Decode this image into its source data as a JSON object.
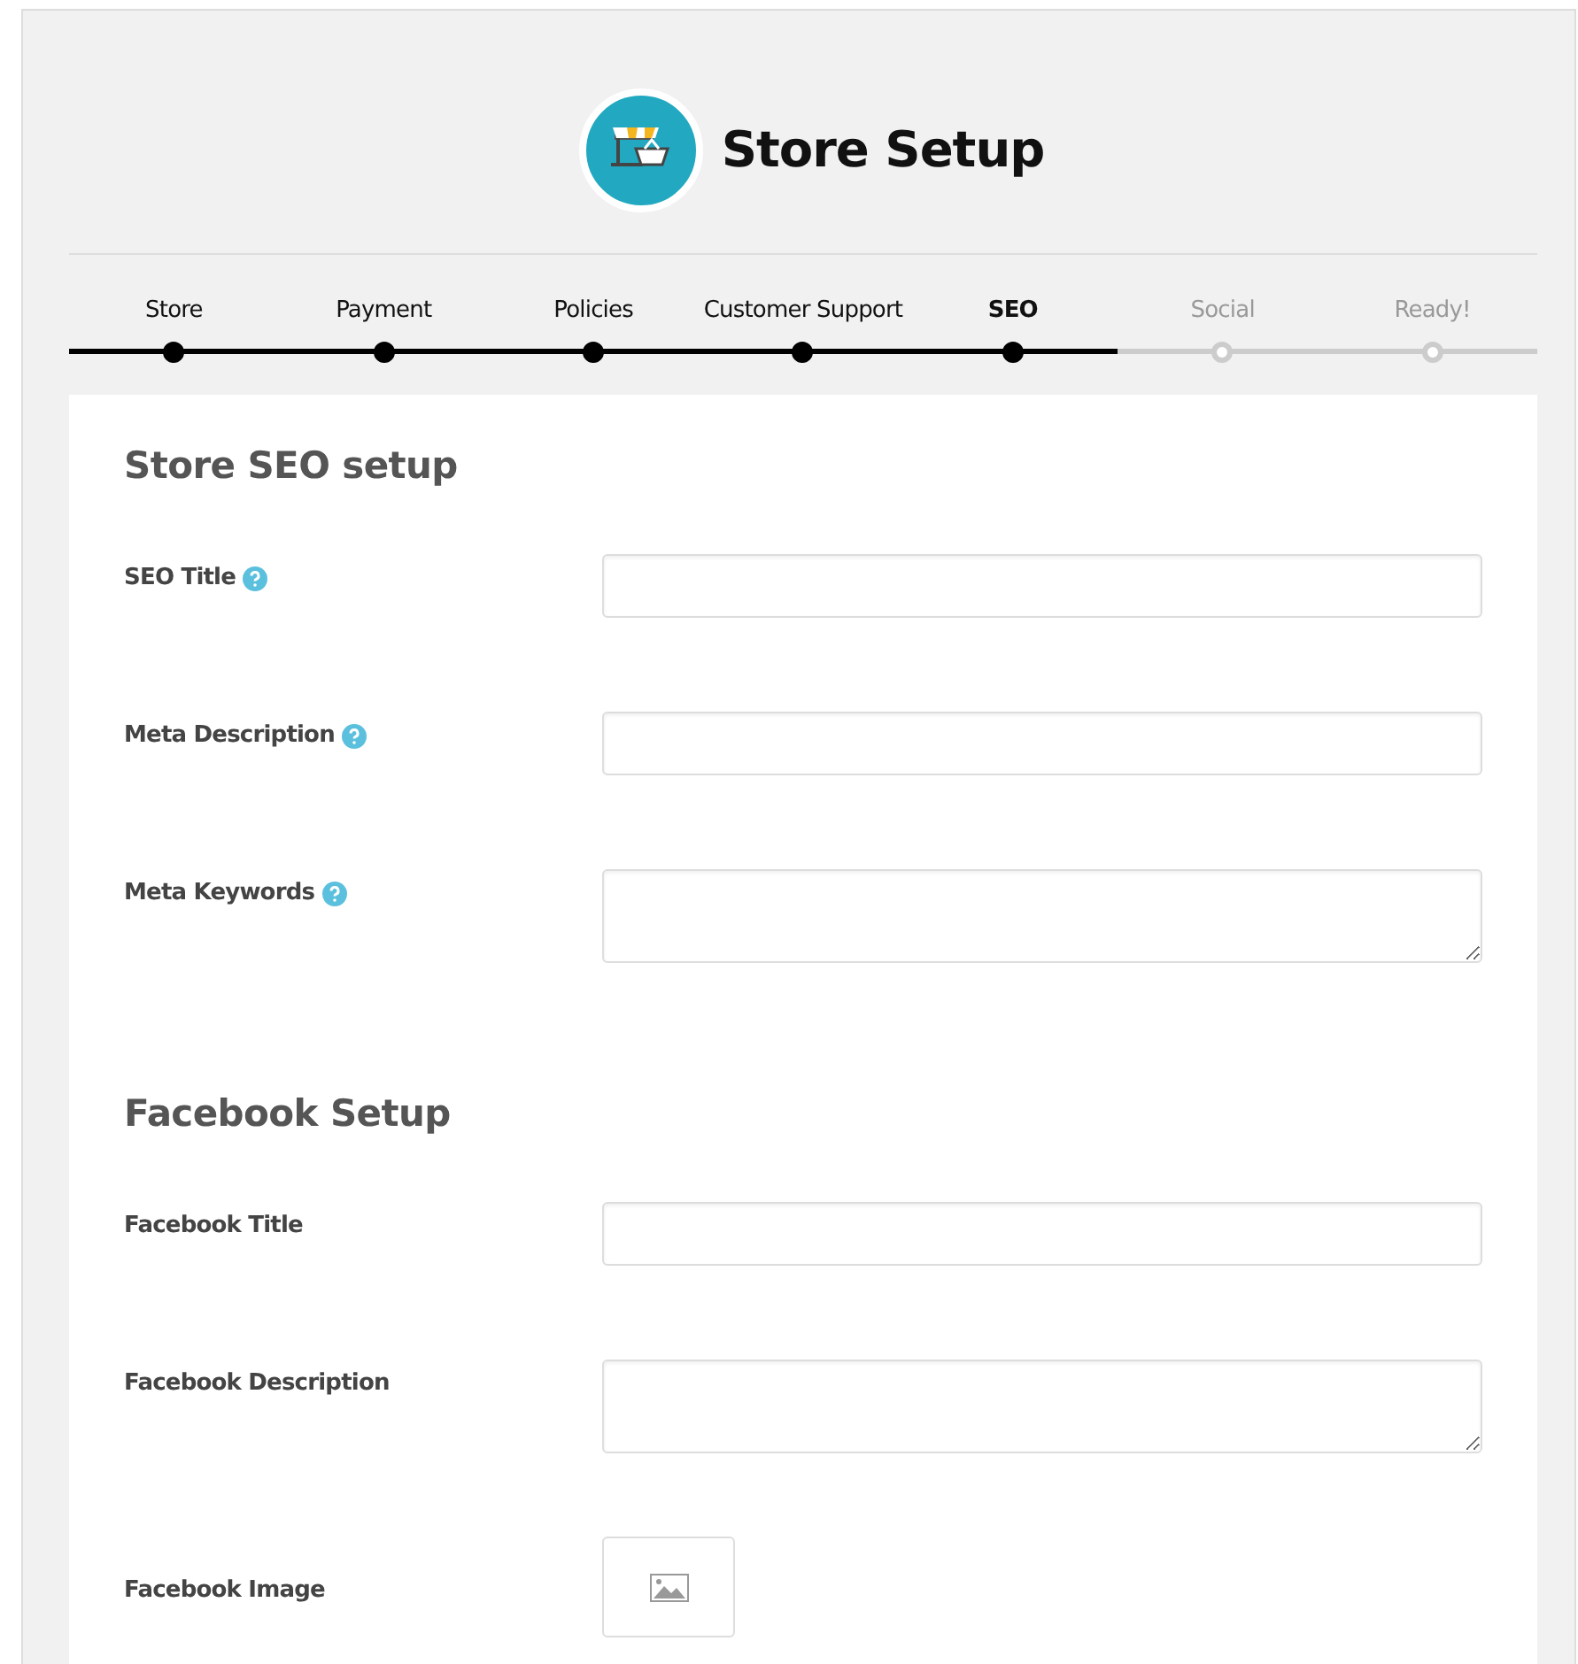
{
  "header": {
    "title": "Store Setup"
  },
  "steps": [
    {
      "label": "Store",
      "completed": true,
      "selected": false
    },
    {
      "label": "Payment",
      "completed": true,
      "selected": false
    },
    {
      "label": "Policies",
      "completed": true,
      "selected": false
    },
    {
      "label": "Customer Support",
      "completed": true,
      "selected": false
    },
    {
      "label": "SEO",
      "completed": false,
      "selected": true
    },
    {
      "label": "Social",
      "completed": false,
      "selected": false
    },
    {
      "label": "Ready!",
      "completed": false,
      "selected": false
    }
  ],
  "sections": [
    {
      "heading": "Store SEO setup",
      "fields": [
        {
          "label": "SEO Title",
          "kind": "input",
          "help": true
        },
        {
          "label": "Meta Description",
          "kind": "input",
          "help": true
        },
        {
          "label": "Meta Keywords",
          "kind": "textarea",
          "help": true
        }
      ]
    },
    {
      "heading": "Facebook Setup",
      "fields": [
        {
          "label": "Facebook Title",
          "kind": "input",
          "help": false
        },
        {
          "label": "Facebook Description",
          "kind": "textarea",
          "help": false
        },
        {
          "label": "Facebook Image",
          "kind": "image",
          "help": false
        }
      ]
    }
  ]
}
